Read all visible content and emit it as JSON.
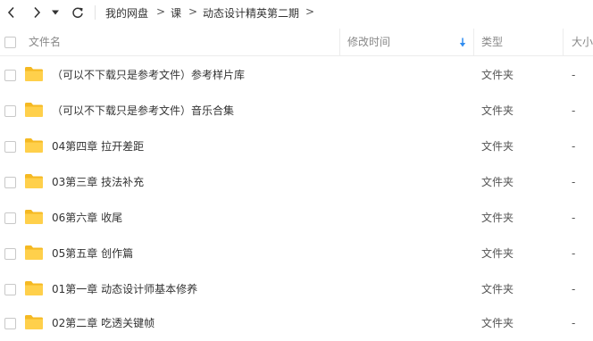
{
  "toolbar": {
    "breadcrumb": [
      "我的网盘",
      "课",
      "动态设计精英第二期"
    ],
    "separator": ">"
  },
  "columns": {
    "name": "文件名",
    "modified": "修改时间",
    "type": "类型",
    "size": "大小"
  },
  "rows": [
    {
      "name": "（可以不下载只是参考文件）参考样片库",
      "type": "文件夹",
      "size": "-"
    },
    {
      "name": "（可以不下载只是参考文件）音乐合集",
      "type": "文件夹",
      "size": "-"
    },
    {
      "name": "04第四章 拉开差距",
      "type": "文件夹",
      "size": "-"
    },
    {
      "name": "03第三章 技法补充",
      "type": "文件夹",
      "size": "-"
    },
    {
      "name": "06第六章 收尾",
      "type": "文件夹",
      "size": "-"
    },
    {
      "name": "05第五章 创作篇",
      "type": "文件夹",
      "size": "-"
    },
    {
      "name": "01第一章 动态设计师基本修养",
      "type": "文件夹",
      "size": "-"
    },
    {
      "name": "02第二章 吃透关键帧",
      "type": "文件夹",
      "size": "-"
    }
  ],
  "colors": {
    "folder": "#ffd04b",
    "folder_tab": "#f5b922",
    "sort_arrow": "#2f8cf0"
  },
  "icons": {
    "back": "chevron-left-icon",
    "forward": "chevron-right-icon",
    "history": "caret-down-icon",
    "refresh": "refresh-icon",
    "sort": "arrow-down-icon",
    "folder": "folder-icon"
  }
}
